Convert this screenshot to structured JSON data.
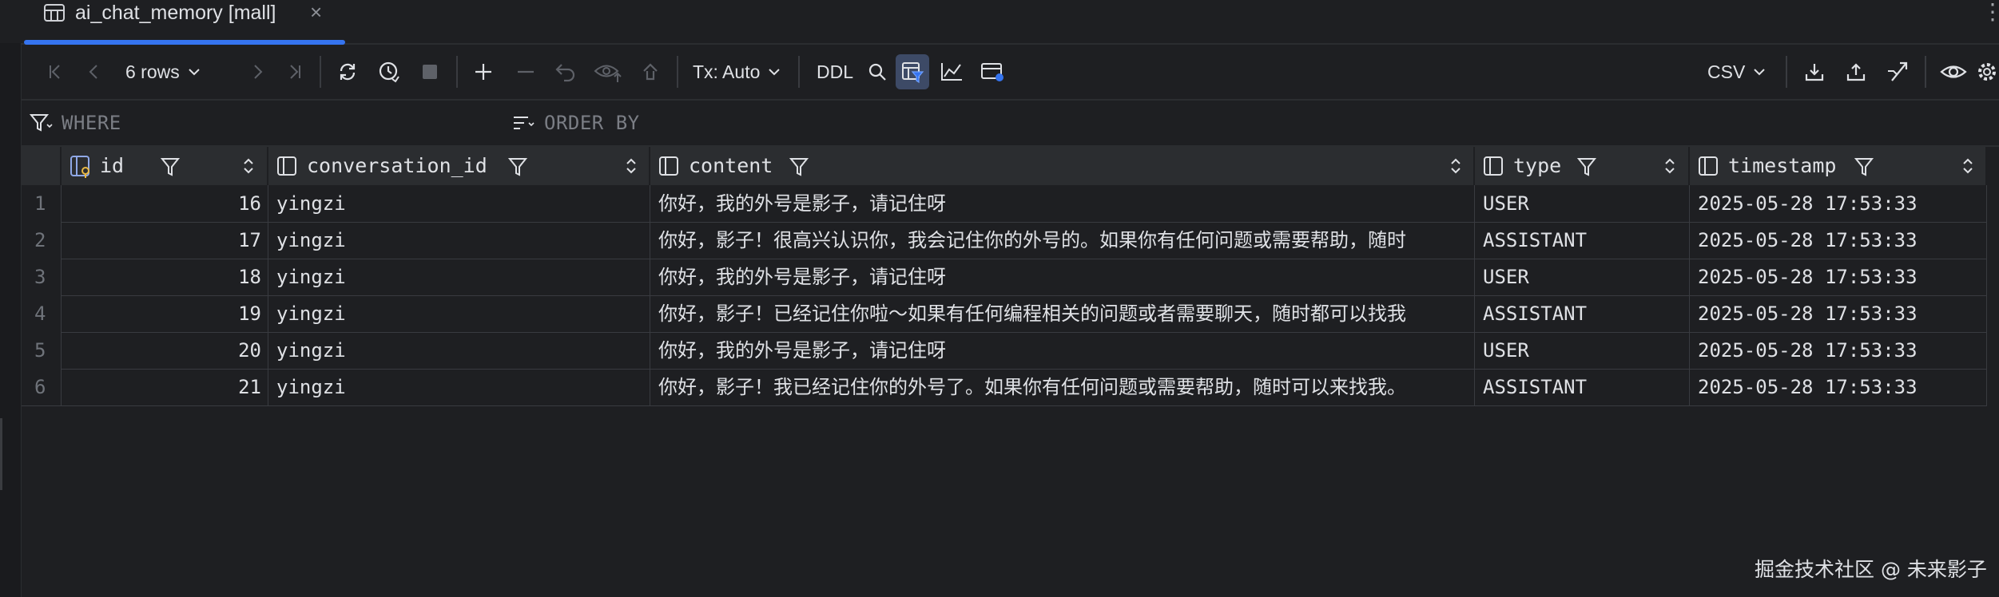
{
  "tab": {
    "title": "ai_chat_memory [mall]",
    "close": "×"
  },
  "toolbar": {
    "rows_label": "6 rows",
    "tx_label": "Tx: Auto",
    "ddl_label": "DDL",
    "export_format": "CSV"
  },
  "filter": {
    "where": "WHERE",
    "order_by": "ORDER BY"
  },
  "columns": [
    {
      "name": "id"
    },
    {
      "name": "conversation_id"
    },
    {
      "name": "content"
    },
    {
      "name": "type"
    },
    {
      "name": "timestamp"
    }
  ],
  "rows": [
    {
      "n": "1",
      "id": "16",
      "conversation_id": "yingzi",
      "content": "你好，我的外号是影子，请记住呀",
      "type": "USER",
      "timestamp": "2025-05-28 17:53:33"
    },
    {
      "n": "2",
      "id": "17",
      "conversation_id": "yingzi",
      "content": "你好，影子！很高兴认识你，我会记住你的外号的。如果你有任何问题或需要帮助，随时",
      "type": "ASSISTANT",
      "timestamp": "2025-05-28 17:53:33"
    },
    {
      "n": "3",
      "id": "18",
      "conversation_id": "yingzi",
      "content": "你好，我的外号是影子，请记住呀",
      "type": "USER",
      "timestamp": "2025-05-28 17:53:33"
    },
    {
      "n": "4",
      "id": "19",
      "conversation_id": "yingzi",
      "content": "你好，影子！已经记住你啦～如果有任何编程相关的问题或者需要聊天，随时都可以找我",
      "type": "ASSISTANT",
      "timestamp": "2025-05-28 17:53:33"
    },
    {
      "n": "5",
      "id": "20",
      "conversation_id": "yingzi",
      "content": "你好，我的外号是影子，请记住呀",
      "type": "USER",
      "timestamp": "2025-05-28 17:53:33"
    },
    {
      "n": "6",
      "id": "21",
      "conversation_id": "yingzi",
      "content": "你好，影子！我已经记住你的外号了。如果你有任何问题或需要帮助，随时可以来找我。",
      "type": "ASSISTANT",
      "timestamp": "2025-05-28 17:53:33"
    }
  ],
  "watermark": "掘金技术社区 @ 未来影子"
}
